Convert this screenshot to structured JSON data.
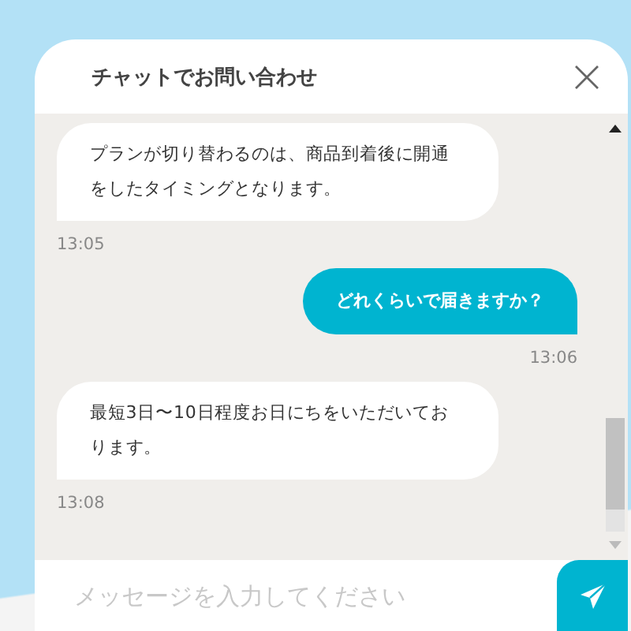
{
  "header": {
    "title": "チャットでお問い合わせ"
  },
  "messages": [
    {
      "kind": "bot",
      "text": "プランが切り替わるのは、商品到着後に開通をしたタイミングとなります。",
      "time": "13:05"
    },
    {
      "kind": "user",
      "text": "どれくらいで届きますか？",
      "time": "13:06"
    },
    {
      "kind": "bot",
      "text": "最短3日〜10日程度お日にちをいただいております。",
      "time": "13:08"
    }
  ],
  "input": {
    "placeholder": "メッセージを入力してください"
  }
}
